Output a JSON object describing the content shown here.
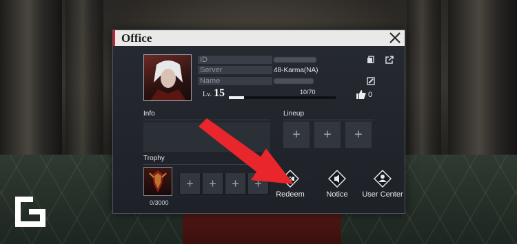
{
  "window": {
    "title": "Office"
  },
  "profile": {
    "id_label": "ID",
    "server_label": "Server",
    "server_value": "48-Karma(NA)",
    "name_label": "Name",
    "level_prefix": "Lv.",
    "level": "15",
    "xp_text": "10/70",
    "xp_fraction": 0.143,
    "likes": "0"
  },
  "sections": {
    "info_label": "Info",
    "lineup_label": "Lineup",
    "trophy_label": "Trophy",
    "trophy_count": "0/3000",
    "slot_symbol": "+"
  },
  "actions": [
    {
      "label": "Redeem",
      "icon": "ticket-icon"
    },
    {
      "label": "Notice",
      "icon": "megaphone-icon"
    },
    {
      "label": "User Center",
      "icon": "user-icon"
    }
  ],
  "colors": {
    "accent": "#c8202a",
    "arrow": "#e8262b"
  }
}
